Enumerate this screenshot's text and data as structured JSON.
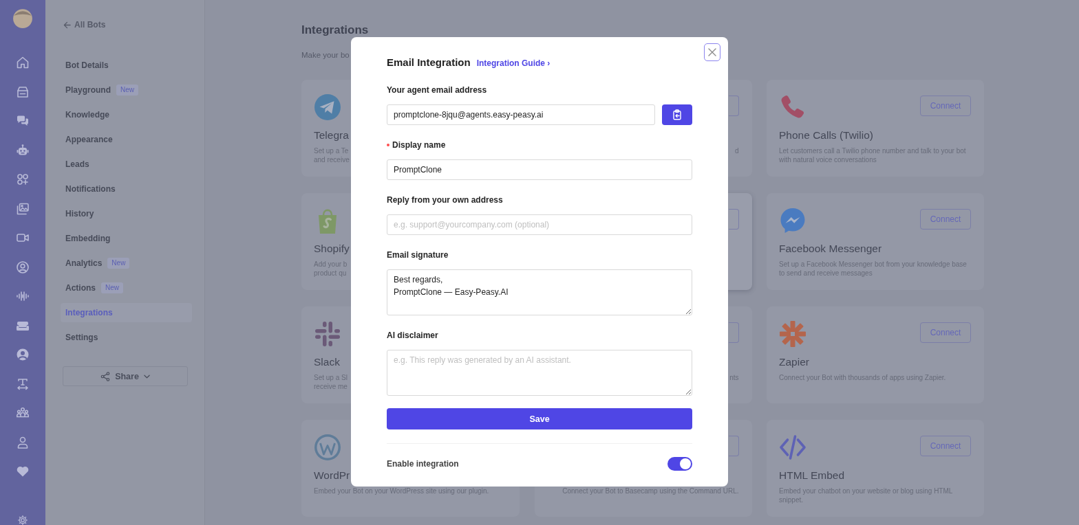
{
  "sidebar": {
    "back_link": "All Bots",
    "items": [
      {
        "label": "Bot Details",
        "selected": false
      },
      {
        "label": "Playground",
        "badge": "New",
        "selected": false
      },
      {
        "label": "Knowledge",
        "selected": false
      },
      {
        "label": "Appearance",
        "selected": false
      },
      {
        "label": "Leads",
        "selected": false
      },
      {
        "label": "Notifications",
        "selected": false
      },
      {
        "label": "History",
        "selected": false
      },
      {
        "label": "Embedding",
        "selected": false
      },
      {
        "label": "Analytics",
        "badge": "New",
        "selected": false
      },
      {
        "label": "Actions",
        "badge": "New",
        "selected": false
      },
      {
        "label": "Integrations",
        "selected": true
      },
      {
        "label": "Settings",
        "selected": false
      }
    ],
    "share_button": "Share"
  },
  "page": {
    "title": "Integrations",
    "subtitle": "Make your bo",
    "columns": [
      {
        "kind": "cut-right",
        "cards": [
          {
            "title": "Telegra",
            "description": [
              "Set up a Te",
              "and receive"
            ]
          },
          {
            "title": "Shopify",
            "description": [
              "Add your b",
              "product qu"
            ]
          },
          {
            "title": "Slack",
            "description": [
              "Set up a Sl",
              "receive me"
            ]
          },
          {
            "title": "WordPr",
            "description": [
              "Embed your Bot on your WordPress site using our plugin."
            ]
          }
        ]
      },
      {
        "kind": "cut-left",
        "cards": [
          {
            "description": [
              "d"
            ],
            "hovered": false
          },
          {
            "hovered": true
          },
          {
            "description": [
              "nts"
            ],
            "hovered": false
          },
          {
            "description": [
              "Connect your Bot to Basecamp using the Command URL."
            ],
            "hovered": false
          }
        ]
      },
      {
        "kind": "full",
        "cards": [
          {
            "title": "Phone Calls (Twilio)",
            "description": "Let customers call a Twilio phone number and talk to your bot with natural voice conversations",
            "button": "Connect"
          },
          {
            "title": "Facebook Messenger",
            "description": "Set up a Facebook Messenger bot from your knowledge base to send and receive messages",
            "button": "Connect"
          },
          {
            "title": "Zapier",
            "description": "Connect your Bot with thousands of apps using Zapier.",
            "button": "Connect"
          },
          {
            "title": "HTML Embed",
            "description": "Embed your chatbot on your website or blog using HTML snippet.",
            "button": "Connect"
          }
        ]
      }
    ]
  },
  "modal": {
    "title": "Email Integration",
    "link": "Integration Guide ›",
    "close_button": {
      "focused": true
    },
    "fields": [
      {
        "kind": "copy-input",
        "label": "Your agent email address",
        "required": false,
        "value": "promptclone-8jqu@agents.easy-peasy.ai"
      },
      {
        "kind": "input",
        "label": "Display name",
        "required": true,
        "value": "PromptClone"
      },
      {
        "kind": "input",
        "label": "Reply from your own address",
        "required": false,
        "placeholder": "e.g. support@yourcompany.com (optional)"
      },
      {
        "kind": "textarea",
        "label": "Email signature",
        "required": false,
        "value": "Best regards,\nPromptClone — Easy-Peasy.AI"
      },
      {
        "kind": "textarea",
        "label": "AI disclaimer",
        "required": false,
        "placeholder": "e.g. This reply was generated by an AI assistant."
      }
    ],
    "save_button": "Save",
    "enable": {
      "label": "Enable integration",
      "on": true
    }
  }
}
